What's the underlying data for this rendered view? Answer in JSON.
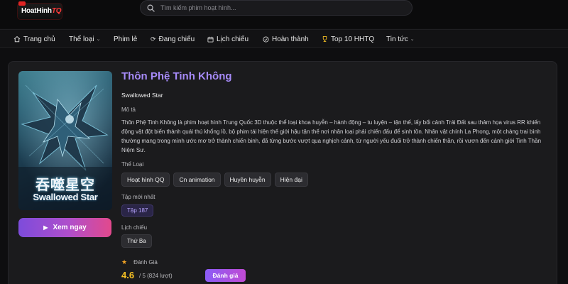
{
  "header": {
    "logo_text_main": "HoatHinh",
    "logo_text_accent": "TQ",
    "search_placeholder": "Tìm kiếm phim hoạt hình..."
  },
  "nav": [
    {
      "label": "Trang chủ",
      "icon": "home-icon"
    },
    {
      "label": "Thể loại",
      "icon": null,
      "dropdown": true
    },
    {
      "label": "Phim lẻ",
      "icon": null
    },
    {
      "label": "Đang chiếu",
      "icon": "refresh-icon"
    },
    {
      "label": "Lịch chiếu",
      "icon": "calendar-icon"
    },
    {
      "label": "Hoàn thành",
      "icon": "check-circle-icon"
    },
    {
      "label": "Top 10 HHTQ",
      "icon": "trophy-icon"
    },
    {
      "label": "Tin tức",
      "icon": null,
      "dropdown": true
    }
  ],
  "movie": {
    "title": "Thôn Phệ Tinh Không",
    "original_title": "Swallowed Star",
    "poster_title_cn": "吞噬星空",
    "poster_title_en": "Swallowed Star",
    "watch_label": "Xem ngay",
    "description_label": "Mô tả",
    "description": "Thôn Phệ Tinh Không là phim hoạt hình Trung Quốc 3D thuộc thể loại khoa huyễn – hành động – tu luyện – tận thế, lấy bối cảnh Trái Đất sau thảm họa virus RR khiến động vật đột biến thành quái thú khổng lồ, bộ phim tái hiện thế giới hậu tận thế nơi nhân loại phải chiến đấu để sinh tồn. Nhân vật chính La Phong, một chàng trai bình thường mang trong mình ước mơ trở thành chiến binh, đã từng bước vượt qua nghịch cảnh, từ người yếu đuối trở thành chiến thần, rồi vươn đến cảnh giới Tinh Thần Niệm Sư.",
    "genres_label": "Thể Loại",
    "genres": [
      "Hoạt hình QQ",
      "Cn animation",
      "Huyền huyễn",
      "Hiện đại"
    ],
    "latest_label": "Tập mới nhất",
    "latest_episode": "Tập 187",
    "schedule_label": "Lịch chiếu",
    "schedule_day": "Thứ Ba",
    "rating_label": "Đánh Giá",
    "rating_score": "4.6",
    "rating_meta": "/ 5 (824 lượt)",
    "rate_button": "Đánh giá"
  },
  "colors": {
    "title_accent": "#a78bfa",
    "rating_star": "#f5a524",
    "watch_gradient": [
      "#7d4cdb",
      "#e2498c"
    ]
  }
}
